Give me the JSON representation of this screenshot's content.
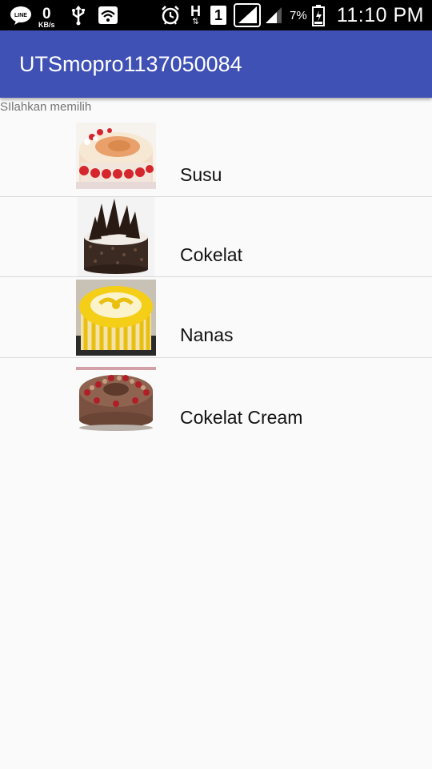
{
  "status_bar": {
    "net_speed_value": "0",
    "net_speed_unit": "KB/s",
    "network_type": "H",
    "sim_slot": "1",
    "battery_percent": "7%",
    "time": "11:10 PM"
  },
  "app_bar": {
    "title": "UTSmopro1137050084"
  },
  "subtitle": "SIlahkan memilih",
  "items": [
    {
      "label": "Susu",
      "icon": "milk-cake-image"
    },
    {
      "label": "Cokelat",
      "icon": "chocolate-cake-image"
    },
    {
      "label": "Nanas",
      "icon": "pineapple-cake-image"
    },
    {
      "label": "Cokelat Cream",
      "icon": "chocolate-cream-cake-image"
    }
  ],
  "colors": {
    "app_bar": "#3f51b5",
    "status_bar": "#000000",
    "background": "#fafafa"
  }
}
